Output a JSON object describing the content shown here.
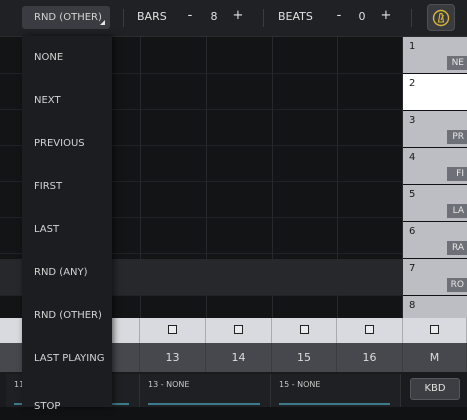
{
  "topbar": {
    "random_mode": "RND (OTHER)",
    "bars_label": "BARS",
    "bars_minus": "-",
    "bars_value": "8",
    "bars_plus": "+",
    "beats_label": "BEATS",
    "beats_minus": "-",
    "beats_value": "0",
    "beats_plus": "+",
    "metronome_icon": "metronome-icon"
  },
  "dropdown": {
    "options": [
      "NONE",
      "NEXT",
      "PREVIOUS",
      "FIRST",
      "LAST",
      "RND (ANY)",
      "RND (OTHER)",
      "LAST PLAYING",
      "STOP"
    ]
  },
  "slots": [
    {
      "num": "1",
      "tag": "NE"
    },
    {
      "num": "2",
      "tag": ""
    },
    {
      "num": "3",
      "tag": "PR"
    },
    {
      "num": "4",
      "tag": "FI"
    },
    {
      "num": "5",
      "tag": "LA"
    },
    {
      "num": "6",
      "tag": "RA"
    },
    {
      "num": "7",
      "tag": "RO"
    },
    {
      "num": "8",
      "tag": ""
    }
  ],
  "columns": {
    "numbers": [
      "13",
      "14",
      "15",
      "16",
      "M"
    ]
  },
  "tracks": [
    {
      "label": "11"
    },
    {
      "label": "13 - NONE"
    },
    {
      "label": "15 - NONE"
    }
  ],
  "kbd_label": "KBD",
  "colors": {
    "accent_yellow": "#d7b63a",
    "track_bar": "#3d7a8c"
  }
}
